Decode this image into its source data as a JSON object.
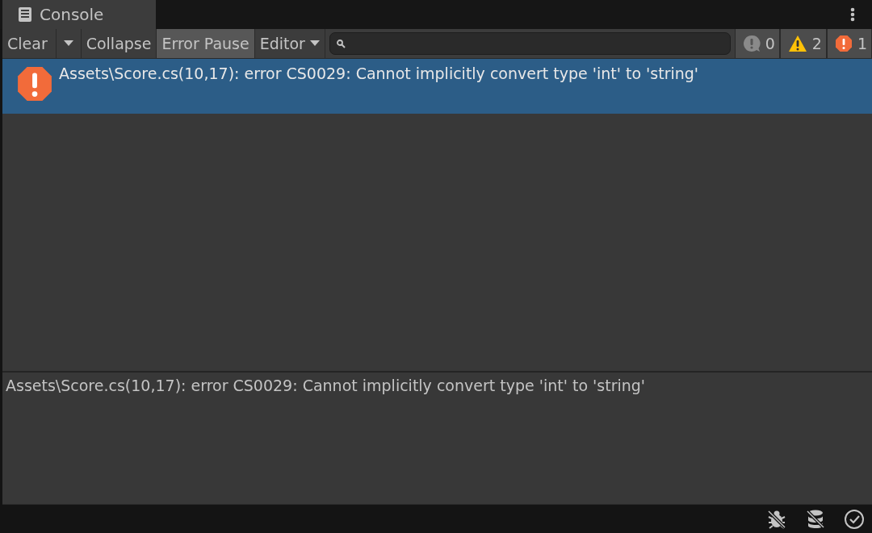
{
  "tab": {
    "title": "Console"
  },
  "toolbar": {
    "clear": "Clear",
    "toggles": [
      {
        "label": "Collapse",
        "selected": false
      },
      {
        "label": "Error Pause",
        "selected": true
      }
    ],
    "editor": "Editor",
    "counters": [
      {
        "kind": "log",
        "count": "0"
      },
      {
        "kind": "warning",
        "count": "2"
      },
      {
        "kind": "error",
        "count": "1"
      }
    ]
  },
  "entries": [
    {
      "kind": "error",
      "text": "Assets\\Score.cs(10,17): error CS0029: Cannot implicitly convert type 'int' to 'string'",
      "selected": true
    }
  ],
  "details": "Assets\\Score.cs(10,17): error CS0029: Cannot implicitly convert type 'int' to 'string'"
}
